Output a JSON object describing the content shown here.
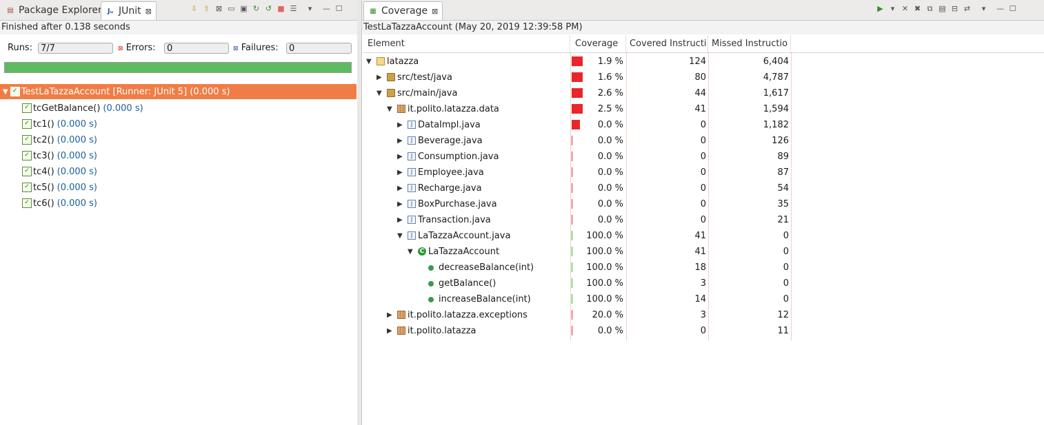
{
  "left": {
    "tabs": [
      {
        "label": "Package Explorer"
      },
      {
        "label": "JUnit",
        "close": "⊠"
      }
    ],
    "toolbar_icons": [
      "next-failure-icon",
      "previous-failure-icon",
      "show-failures-only-icon",
      "scroll-lock-icon",
      "test-run-history-icon",
      "rerun-test-icon",
      "rerun-failed-first-icon",
      "stop-icon",
      "history-icon",
      "view-menu-icon",
      "minimize-icon",
      "maximize-icon"
    ],
    "status": "Finished after 0.138 seconds",
    "runs_label": "Runs:",
    "runs_value": "7/7",
    "errors_label": "Errors:",
    "errors_value": "0",
    "failures_label": "Failures:",
    "failures_value": "0",
    "progress_fraction": 1.0,
    "progress_color": "#5fbb5f",
    "tree": {
      "root_label": "TestLaTazzaAccount [Runner: JUnit 5] (0.000 s)",
      "children": [
        {
          "name": "tcGetBalance()",
          "time": "(0.000 s)"
        },
        {
          "name": "tc1()",
          "time": "(0.000 s)"
        },
        {
          "name": "tc2()",
          "time": "(0.000 s)"
        },
        {
          "name": "tc3()",
          "time": "(0.000 s)"
        },
        {
          "name": "tc4()",
          "time": "(0.000 s)"
        },
        {
          "name": "tc5()",
          "time": "(0.000 s)"
        },
        {
          "name": "tc6()",
          "time": "(0.000 s)"
        }
      ]
    },
    "selection_color": "#f07d45"
  },
  "right": {
    "tab_label": "Coverage",
    "tab_close": "⊠",
    "toolbar_icons": [
      "coverage-launch-icon",
      "dropdown-icon",
      "remove-session-icon",
      "remove-all-sessions-icon",
      "merge-sessions-icon",
      "select-session-icon",
      "collapse-all-icon",
      "link-icon",
      "view-menu-icon",
      "minimize-icon",
      "maximize-icon"
    ],
    "session": "TestLaTazzaAccount (May 20, 2019 12:39:58 PM)",
    "columns": [
      "Element",
      "Coverage",
      "Covered Instructi",
      "Missed Instructio"
    ],
    "rows": [
      {
        "name": "latazza",
        "coverage": "1.9 %",
        "covered": "124",
        "missed": "6,404",
        "level": 0,
        "toggle": "▼",
        "icon": "project"
      },
      {
        "name": "src/test/java",
        "coverage": "1.6 %",
        "covered": "80",
        "missed": "4,787",
        "level": 1,
        "toggle": "▶",
        "icon": "source-folder"
      },
      {
        "name": "src/main/java",
        "coverage": "2.6 %",
        "covered": "44",
        "missed": "1,617",
        "level": 1,
        "toggle": "▼",
        "icon": "source-folder"
      },
      {
        "name": "it.polito.latazza.data",
        "coverage": "2.5 %",
        "covered": "41",
        "missed": "1,594",
        "level": 2,
        "toggle": "▼",
        "icon": "package"
      },
      {
        "name": "DataImpl.java",
        "coverage": "0.0 %",
        "covered": "0",
        "missed": "1,182",
        "level": 3,
        "toggle": "▶",
        "icon": "java-file"
      },
      {
        "name": "Beverage.java",
        "coverage": "0.0 %",
        "covered": "0",
        "missed": "126",
        "level": 3,
        "toggle": "▶",
        "icon": "java-file"
      },
      {
        "name": "Consumption.java",
        "coverage": "0.0 %",
        "covered": "0",
        "missed": "89",
        "level": 3,
        "toggle": "▶",
        "icon": "java-file"
      },
      {
        "name": "Employee.java",
        "coverage": "0.0 %",
        "covered": "0",
        "missed": "87",
        "level": 3,
        "toggle": "▶",
        "icon": "java-file"
      },
      {
        "name": "Recharge.java",
        "coverage": "0.0 %",
        "covered": "0",
        "missed": "54",
        "level": 3,
        "toggle": "▶",
        "icon": "java-file"
      },
      {
        "name": "BoxPurchase.java",
        "coverage": "0.0 %",
        "covered": "0",
        "missed": "35",
        "level": 3,
        "toggle": "▶",
        "icon": "java-file"
      },
      {
        "name": "Transaction.java",
        "coverage": "0.0 %",
        "covered": "0",
        "missed": "21",
        "level": 3,
        "toggle": "▶",
        "icon": "java-file"
      },
      {
        "name": "LaTazzaAccount.java",
        "coverage": "100.0 %",
        "covered": "41",
        "missed": "0",
        "level": 3,
        "toggle": "▼",
        "icon": "java-file"
      },
      {
        "name": "LaTazzaAccount",
        "coverage": "100.0 %",
        "covered": "41",
        "missed": "0",
        "level": 4,
        "toggle": "▼",
        "icon": "class"
      },
      {
        "name": "decreaseBalance(int)",
        "coverage": "100.0 %",
        "covered": "18",
        "missed": "0",
        "level": 5,
        "toggle": "",
        "icon": "method"
      },
      {
        "name": "getBalance()",
        "coverage": "100.0 %",
        "covered": "3",
        "missed": "0",
        "level": 5,
        "toggle": "",
        "icon": "method"
      },
      {
        "name": "increaseBalance(int)",
        "coverage": "100.0 %",
        "covered": "14",
        "missed": "0",
        "level": 5,
        "toggle": "",
        "icon": "method"
      },
      {
        "name": "it.polito.latazza.exceptions",
        "coverage": "20.0 %",
        "covered": "3",
        "missed": "12",
        "level": 2,
        "toggle": "▶",
        "icon": "package"
      },
      {
        "name": "it.polito.latazza",
        "coverage": "0.0 %",
        "covered": "0",
        "missed": "11",
        "level": 2,
        "toggle": "▶",
        "icon": "package"
      }
    ],
    "colors": {
      "covered": "#2fb22f",
      "missed": "#e8262b"
    }
  }
}
